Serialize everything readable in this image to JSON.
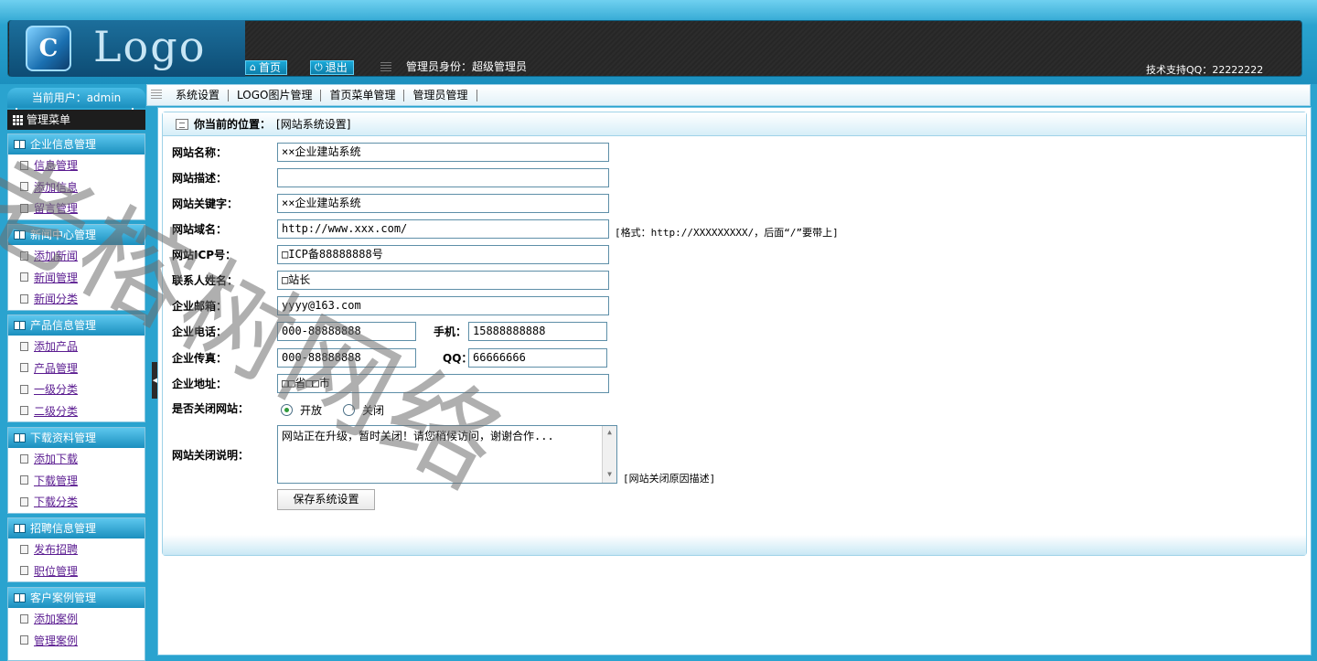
{
  "header": {
    "logo_text": "Logo",
    "home_label": "首页",
    "logout_label": "退出",
    "admin_role": "管理员身份：超级管理员",
    "support": "技术支持QQ：22222222"
  },
  "sidebar": {
    "current_user": "当前用户：admin",
    "menu_title": "管理菜单",
    "groups": [
      {
        "title": "企业信息管理",
        "items": [
          "信息管理",
          "添加信息",
          "留言管理"
        ]
      },
      {
        "title": "新闻中心管理",
        "items": [
          "添加新闻",
          "新闻管理",
          "新闻分类"
        ]
      },
      {
        "title": "产品信息管理",
        "items": [
          "添加产品",
          "产品管理",
          "一级分类",
          "二级分类"
        ]
      },
      {
        "title": "下载资料管理",
        "items": [
          "添加下载",
          "下载管理",
          "下载分类"
        ]
      },
      {
        "title": "招聘信息管理",
        "items": [
          "发布招聘",
          "职位管理"
        ]
      },
      {
        "title": "客户案例管理",
        "items": [
          "添加案例",
          "管理案例"
        ]
      }
    ]
  },
  "tabs": [
    "系统设置",
    "LOGO图片管理",
    "首页菜单管理",
    "管理员管理"
  ],
  "breadcrumb": {
    "label": "你当前的位置：",
    "value": "[网站系统设置]"
  },
  "form": {
    "site_name": {
      "label": "网站名称：",
      "value": "××企业建站系统"
    },
    "site_desc": {
      "label": "网站描述：",
      "value": ""
    },
    "site_keywords": {
      "label": "网站关键字：",
      "value": "××企业建站系统"
    },
    "site_domain": {
      "label": "网站域名：",
      "value": "http://www.xxx.com/",
      "hint": "[格式：http://XXXXXXXXX/，后面“/”要带上]"
    },
    "icp": {
      "label": "网站ICP号：",
      "value": "□ICP备88888888号"
    },
    "contact": {
      "label": "联系人姓名：",
      "value": "□站长"
    },
    "email": {
      "label": "企业邮箱：",
      "value": "yyyy@163.com"
    },
    "phone": {
      "label": "企业电话：",
      "value": "000-88888888",
      "mobile_label": "手机：",
      "mobile_value": "15888888888"
    },
    "fax": {
      "label": "企业传真：",
      "value": "000-88888888",
      "qq_label": "QQ：",
      "qq_value": "66666666"
    },
    "address": {
      "label": "企业地址：",
      "value": "□□省□□市"
    },
    "close_site": {
      "label": "是否关闭网站：",
      "open_label": "开放",
      "close_label": "关闭",
      "selected": "开放"
    },
    "close_note": {
      "label": "网站关闭说明：",
      "value": "网站正在升级，暂时关闭！请您稍候访问，谢谢合作...",
      "hint": "[网站关闭原因描述]"
    },
    "save_label": "保存系统设置"
  },
  "watermark": "老榕树网络"
}
